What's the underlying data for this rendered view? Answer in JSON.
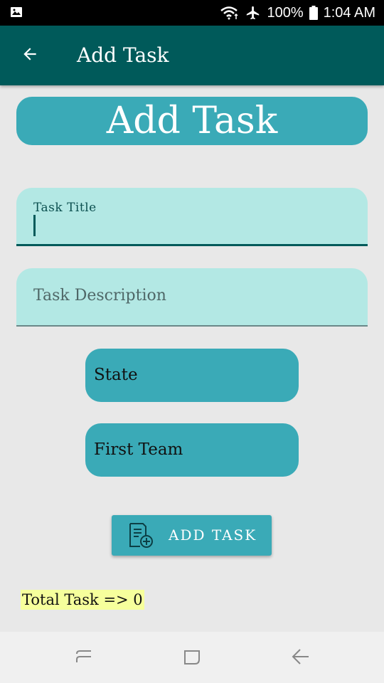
{
  "status_bar": {
    "battery_percent": "100%",
    "time": "1:04 AM",
    "icons": [
      "image-icon",
      "wifi-icon",
      "airplane-icon",
      "battery-icon"
    ]
  },
  "app_bar": {
    "title": "Add Task",
    "back_icon": "arrow-back-icon"
  },
  "banner": {
    "title": "Add Task"
  },
  "form": {
    "task_title_label": "Task Title",
    "task_title_value": "",
    "task_description_placeholder": "Task Description",
    "state_label": "State",
    "team_label": "First Team",
    "add_button_label": "ADD TASK",
    "add_button_icon": "note-add-icon"
  },
  "footer": {
    "total_label": "Total Task => 0"
  },
  "nav_bar": {
    "icons": [
      "recents-icon",
      "home-icon",
      "back-icon"
    ]
  },
  "colors": {
    "app_bar": "#005a5a",
    "accent": "#3aaab7",
    "field_bg": "#b3e8e4",
    "highlight": "#f6ff9c",
    "background": "#e8e8e8"
  }
}
